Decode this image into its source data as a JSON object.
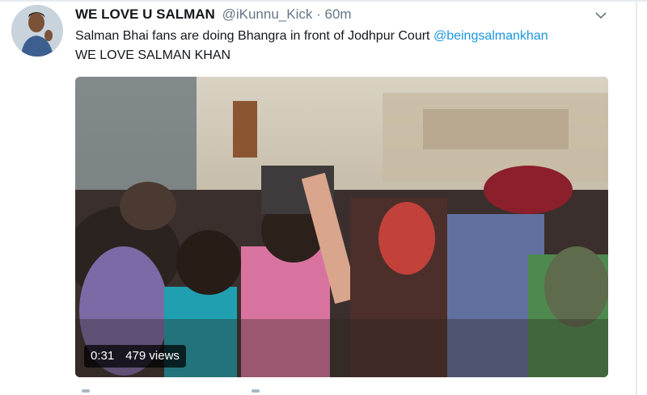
{
  "tweet": {
    "author_name": "WE LOVE U SALMAN",
    "handle": "@iKunnu_Kick",
    "separator": "·",
    "time": "60m",
    "text_line1": "Salman Bhai fans are doing Bhangra in front of Jodhpur Court",
    "mention": "@beingsalmankhan",
    "text_line2": "WE LOVE SALMAN KHAN"
  },
  "video": {
    "duration": "0:31",
    "views": "479 views"
  },
  "icons": {
    "menu": "chevron-down-icon",
    "avatar": "profile-photo"
  },
  "colors": {
    "link": "#1b95e0",
    "secondary_text": "#657786",
    "primary_text": "#14171a"
  }
}
